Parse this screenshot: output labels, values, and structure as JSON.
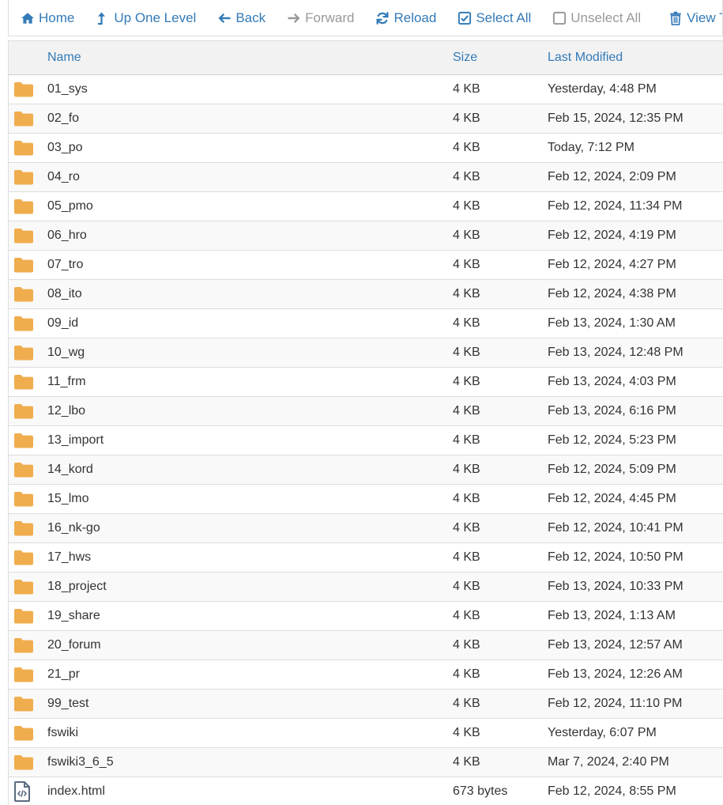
{
  "toolbar": {
    "buttons": [
      {
        "key": "home",
        "label": "Home",
        "icon": "home-icon",
        "disabled": false
      },
      {
        "key": "up",
        "label": "Up One Level",
        "icon": "level-up-icon",
        "disabled": false
      },
      {
        "key": "back",
        "label": "Back",
        "icon": "arrow-left-icon",
        "disabled": false
      },
      {
        "key": "forward",
        "label": "Forward",
        "icon": "arrow-right-icon",
        "disabled": true
      },
      {
        "key": "reload",
        "label": "Reload",
        "icon": "refresh-icon",
        "disabled": false
      },
      {
        "key": "select_all",
        "label": "Select All",
        "icon": "checkbox-checked-icon",
        "disabled": false
      },
      {
        "key": "unselect_all",
        "label": "Unselect All",
        "icon": "checkbox-empty-icon",
        "disabled": true
      },
      {
        "key": "view_trash",
        "label": "View T",
        "icon": "trash-icon",
        "disabled": false
      }
    ]
  },
  "table": {
    "headers": {
      "name": "Name",
      "size": "Size",
      "modified": "Last Modified"
    },
    "rows": [
      {
        "name": "01_sys",
        "size": "4 KB",
        "modified": "Yesterday, 4:48 PM",
        "type": "folder"
      },
      {
        "name": "02_fo",
        "size": "4 KB",
        "modified": "Feb 15, 2024, 12:35 PM",
        "type": "folder"
      },
      {
        "name": "03_po",
        "size": "4 KB",
        "modified": "Today, 7:12 PM",
        "type": "folder"
      },
      {
        "name": "04_ro",
        "size": "4 KB",
        "modified": "Feb 12, 2024, 2:09 PM",
        "type": "folder"
      },
      {
        "name": "05_pmo",
        "size": "4 KB",
        "modified": "Feb 12, 2024, 11:34 PM",
        "type": "folder"
      },
      {
        "name": "06_hro",
        "size": "4 KB",
        "modified": "Feb 12, 2024, 4:19 PM",
        "type": "folder"
      },
      {
        "name": "07_tro",
        "size": "4 KB",
        "modified": "Feb 12, 2024, 4:27 PM",
        "type": "folder"
      },
      {
        "name": "08_ito",
        "size": "4 KB",
        "modified": "Feb 12, 2024, 4:38 PM",
        "type": "folder"
      },
      {
        "name": "09_id",
        "size": "4 KB",
        "modified": "Feb 13, 2024, 1:30 AM",
        "type": "folder"
      },
      {
        "name": "10_wg",
        "size": "4 KB",
        "modified": "Feb 13, 2024, 12:48 PM",
        "type": "folder"
      },
      {
        "name": "11_frm",
        "size": "4 KB",
        "modified": "Feb 13, 2024, 4:03 PM",
        "type": "folder"
      },
      {
        "name": "12_lbo",
        "size": "4 KB",
        "modified": "Feb 13, 2024, 6:16 PM",
        "type": "folder"
      },
      {
        "name": "13_import",
        "size": "4 KB",
        "modified": "Feb 12, 2024, 5:23 PM",
        "type": "folder"
      },
      {
        "name": "14_kord",
        "size": "4 KB",
        "modified": "Feb 12, 2024, 5:09 PM",
        "type": "folder"
      },
      {
        "name": "15_lmo",
        "size": "4 KB",
        "modified": "Feb 12, 2024, 4:45 PM",
        "type": "folder"
      },
      {
        "name": "16_nk-go",
        "size": "4 KB",
        "modified": "Feb 12, 2024, 10:41 PM",
        "type": "folder"
      },
      {
        "name": "17_hws",
        "size": "4 KB",
        "modified": "Feb 12, 2024, 10:50 PM",
        "type": "folder"
      },
      {
        "name": "18_project",
        "size": "4 KB",
        "modified": "Feb 13, 2024, 10:33 PM",
        "type": "folder"
      },
      {
        "name": "19_share",
        "size": "4 KB",
        "modified": "Feb 13, 2024, 1:13 AM",
        "type": "folder"
      },
      {
        "name": "20_forum",
        "size": "4 KB",
        "modified": "Feb 13, 2024, 12:57 AM",
        "type": "folder"
      },
      {
        "name": "21_pr",
        "size": "4 KB",
        "modified": "Feb 13, 2024, 12:26 AM",
        "type": "folder"
      },
      {
        "name": "99_test",
        "size": "4 KB",
        "modified": "Feb 12, 2024, 11:10 PM",
        "type": "folder"
      },
      {
        "name": "fswiki",
        "size": "4 KB",
        "modified": "Yesterday, 6:07 PM",
        "type": "folder"
      },
      {
        "name": "fswiki3_6_5",
        "size": "4 KB",
        "modified": "Mar 7, 2024, 2:40 PM",
        "type": "folder"
      },
      {
        "name": "index.html",
        "size": "673 bytes",
        "modified": "Feb 12, 2024, 8:55 PM",
        "type": "html-file"
      }
    ]
  },
  "colors": {
    "link": "#337ab7",
    "folder": "#f0ad4e",
    "disabled": "#999999",
    "file_icon": "#5a6b80"
  }
}
